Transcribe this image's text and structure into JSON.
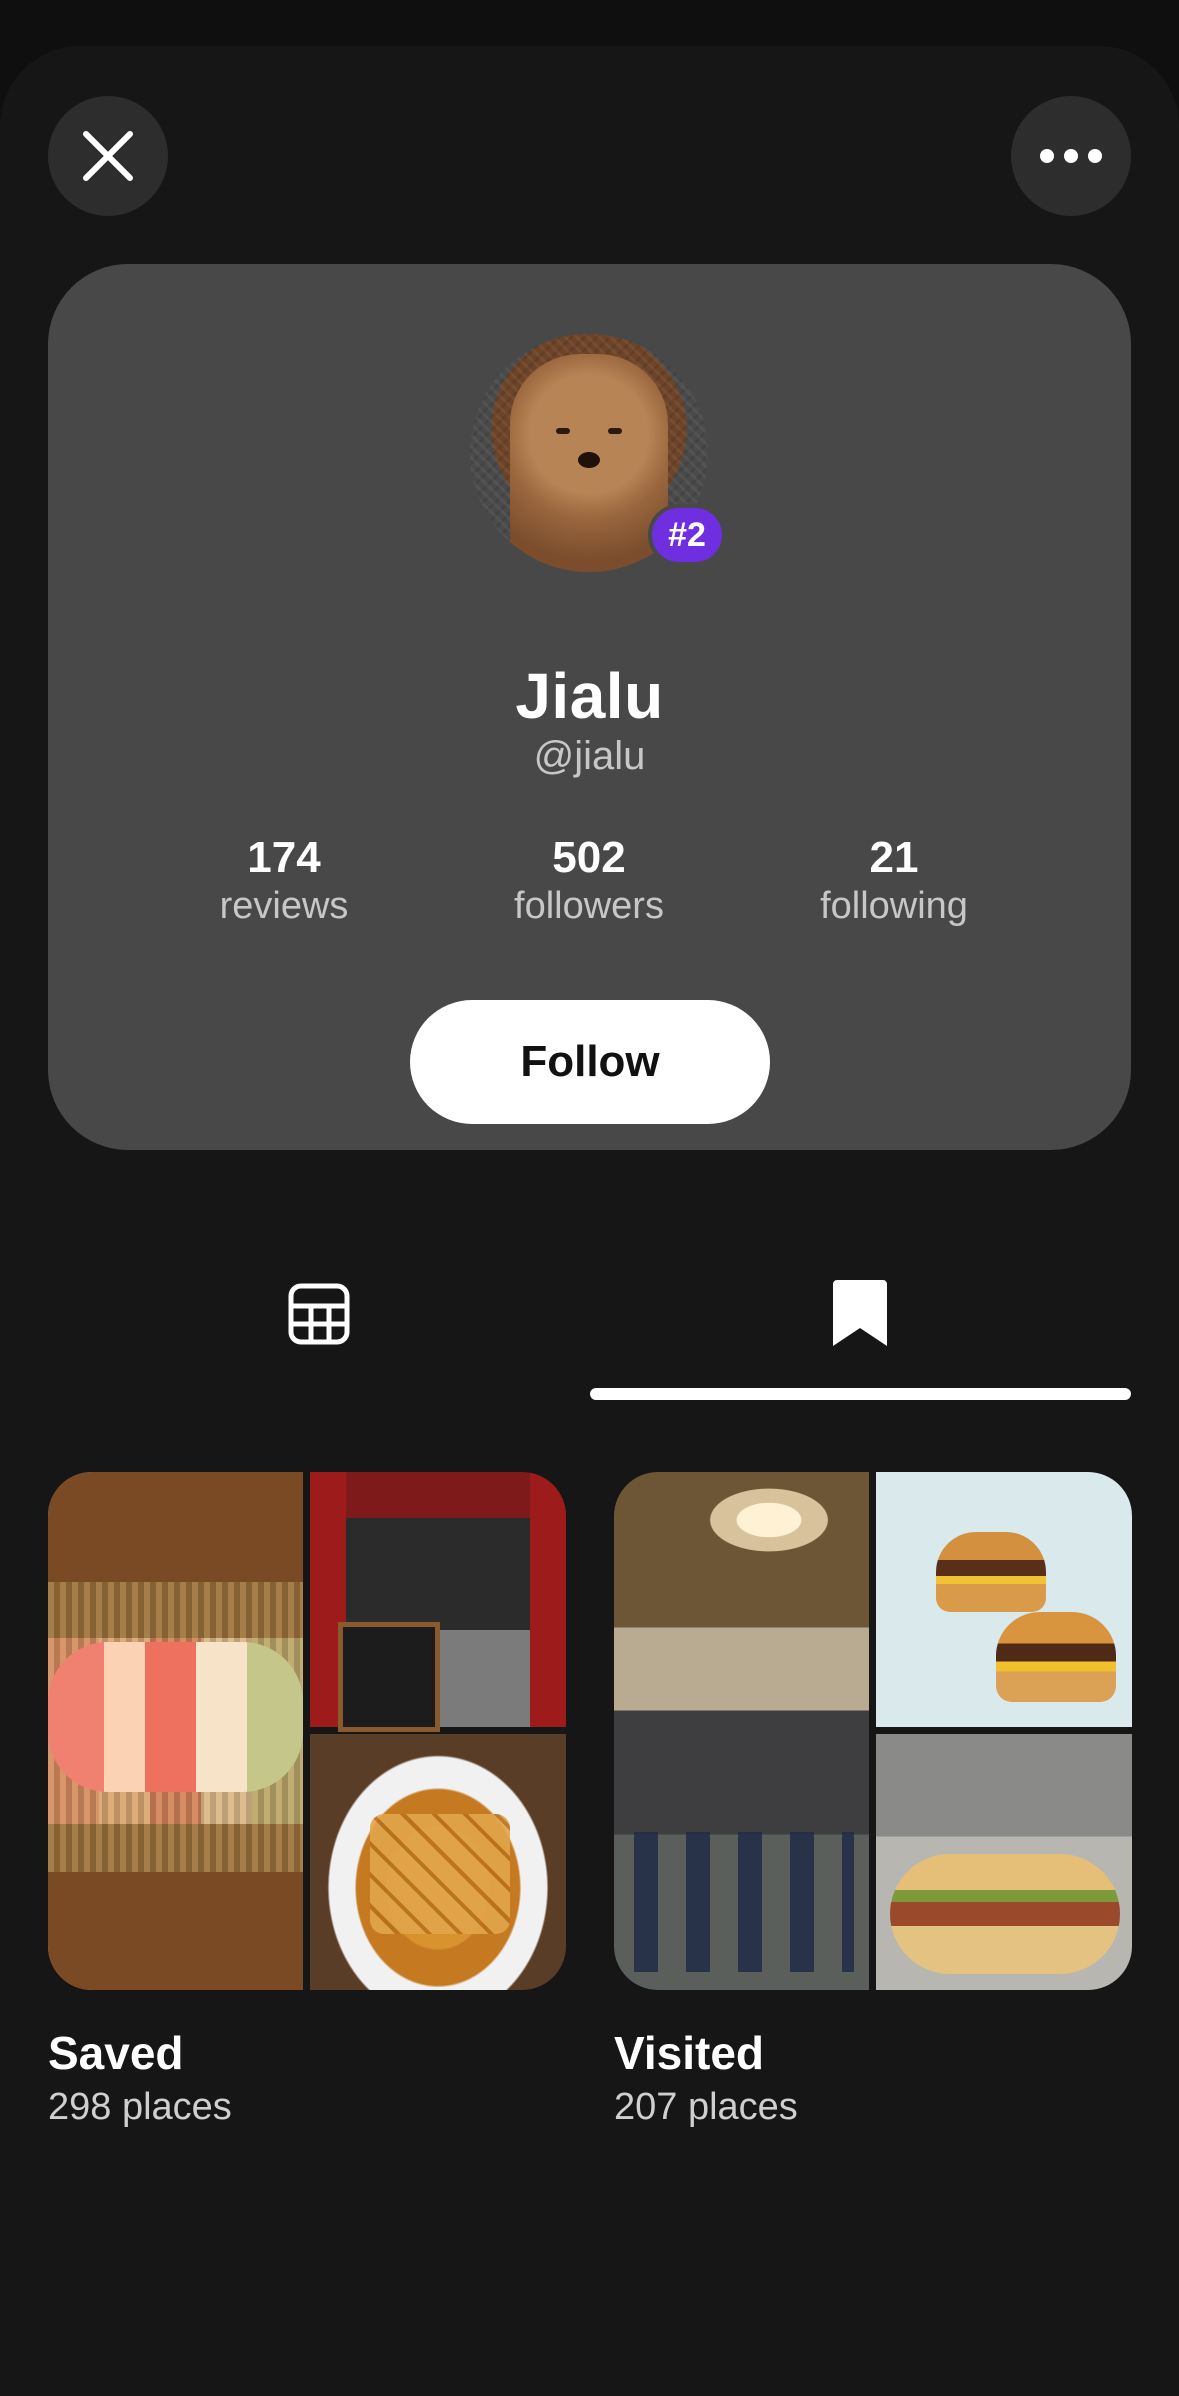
{
  "header": {
    "close_icon": "close-icon",
    "more_icon": "more-horizontal-icon"
  },
  "profile": {
    "name": "Jialu",
    "handle": "@jialu",
    "rank_badge": "#2",
    "avatar": "profile photo of a brown poodle",
    "stats": [
      {
        "value": "174",
        "label": "reviews"
      },
      {
        "value": "502",
        "label": "followers"
      },
      {
        "value": "21",
        "label": "following"
      }
    ],
    "follow_label": "Follow"
  },
  "tabs": [
    {
      "icon": "grid-icon",
      "active": false
    },
    {
      "icon": "bookmark-icon",
      "active": true
    }
  ],
  "collections": [
    {
      "title": "Saved",
      "count": "298 places"
    },
    {
      "title": "Visited",
      "count": "207 places"
    }
  ],
  "colors": {
    "background": "#161616",
    "card": "#484848",
    "badge": "#6f2ee0",
    "follow_button": "#ffffff"
  }
}
